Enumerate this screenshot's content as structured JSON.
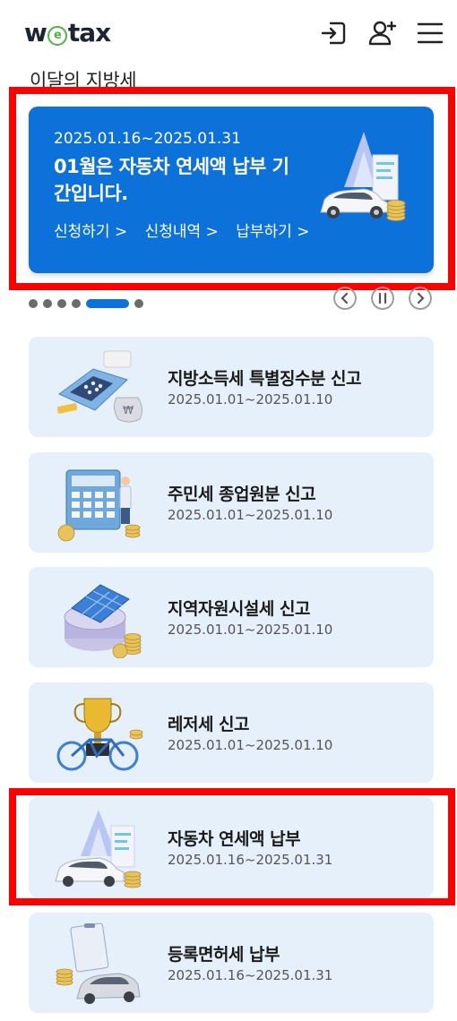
{
  "header": {
    "logo_text": "wetax",
    "icons": [
      "login-icon",
      "add-user-icon",
      "menu-icon"
    ]
  },
  "section_title": "이달의 지방세",
  "banner": {
    "date_range": "2025.01.16~2025.01.31",
    "title": "01월은 자동차 연세액 납부 기간입니다.",
    "links": [
      "신청하기 >",
      "신청내역 >",
      "납부하기 >"
    ],
    "accent": "#0c71d9"
  },
  "carousel": {
    "dot_count": 7,
    "active_index": 4
  },
  "cards": [
    {
      "title": "지방소득세 특별징수분 신고",
      "date": "2025.01.01~2025.01.10",
      "icon": "payment-terminal-icon"
    },
    {
      "title": "주민세 종업원분 신고",
      "date": "2025.01.01~2025.01.10",
      "icon": "calculator-icon"
    },
    {
      "title": "지역자원시설세 신고",
      "date": "2025.01.01~2025.01.10",
      "icon": "solar-panel-icon"
    },
    {
      "title": "레저세 신고",
      "date": "2025.01.01~2025.01.10",
      "icon": "trophy-bicycle-icon"
    },
    {
      "title": "자동차 연세액 납부",
      "date": "2025.01.16~2025.01.31",
      "icon": "car-tax-icon"
    },
    {
      "title": "등록면허세 납부",
      "date": "2025.01.16~2025.01.31",
      "icon": "registration-car-icon"
    }
  ]
}
